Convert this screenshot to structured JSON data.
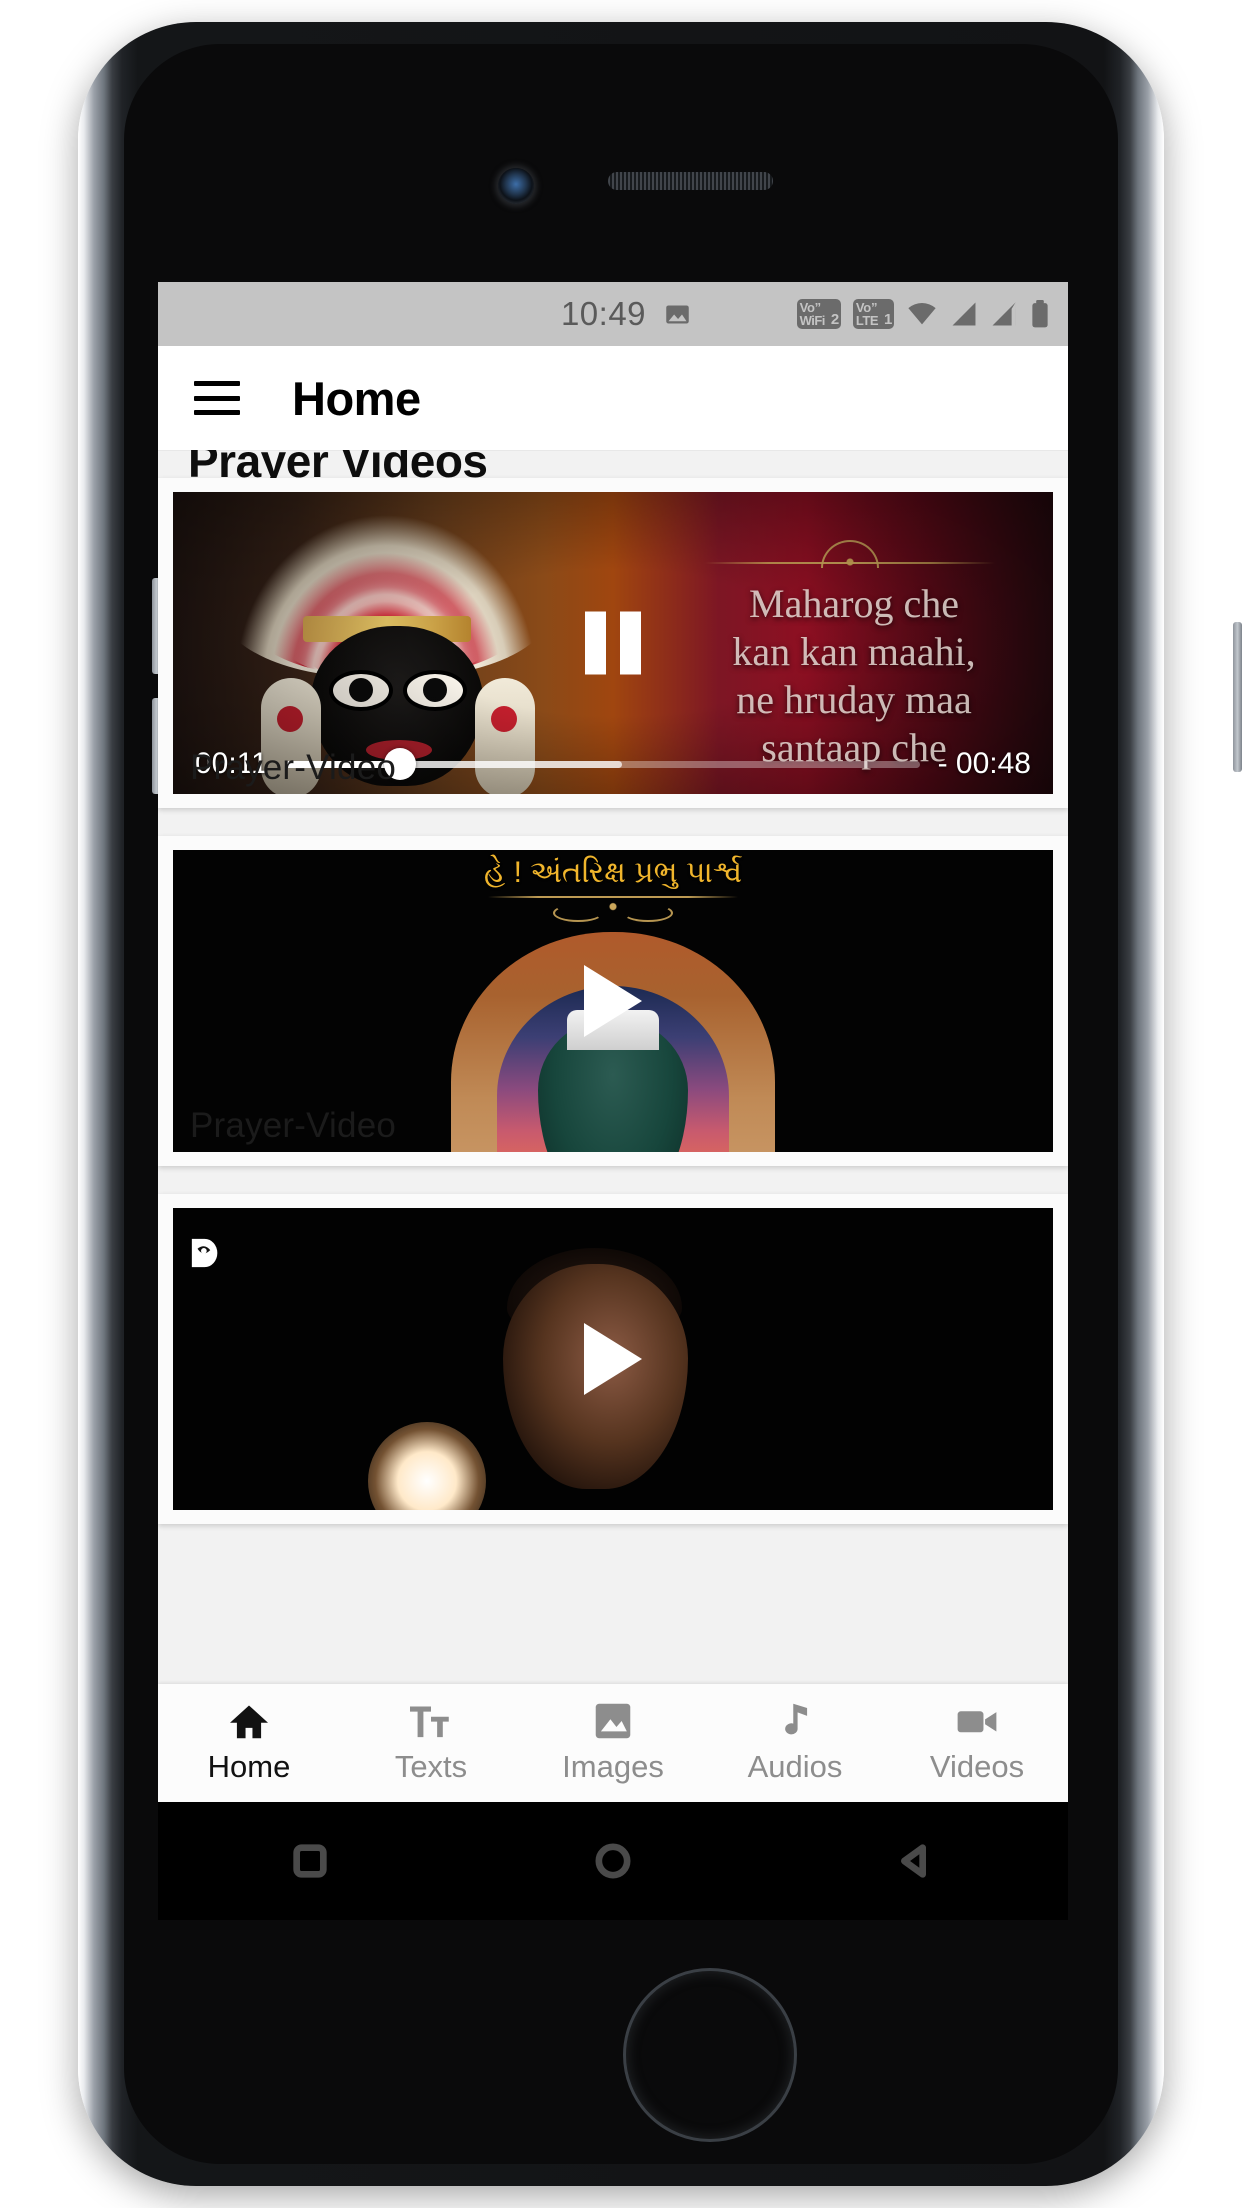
{
  "status_bar": {
    "clock": "10:49",
    "icons": [
      {
        "name": "photo-icon",
        "label": ""
      },
      {
        "name": "vowifi-icon",
        "line1": "Vo\"",
        "line2": "WiFi",
        "num": "2"
      },
      {
        "name": "volte-icon",
        "line1": "Vo\"",
        "line2": "LTE",
        "num": "1"
      },
      {
        "name": "wifi-icon",
        "label": ""
      },
      {
        "name": "signal-sim1-icon",
        "label": ""
      },
      {
        "name": "signal-sim2-icon",
        "label": ""
      },
      {
        "name": "battery-icon",
        "label": ""
      }
    ]
  },
  "app_bar": {
    "menu_icon": "hamburger-menu-icon",
    "title": "Home"
  },
  "content": {
    "section_title": "Prayer Videos",
    "cards": [
      {
        "label": "Prayer-Video",
        "state": "playing",
        "control_icon": "pause-icon",
        "elapsed": "00:11",
        "remaining": "- 00:48",
        "progress_percent": 18,
        "buffered_percent": 53,
        "overlay_lyrics": "Maharog che\nkan kan maahi,\nne hruday maa\nsantaap che"
      },
      {
        "label": "Prayer-Video",
        "state": "paused",
        "control_icon": "play-icon",
        "title_overlay": "હે ! અંતરિક્ષ પ્રભુ પાર્શ્વ"
      },
      {
        "label": "",
        "state": "paused",
        "control_icon": "play-icon",
        "placeholder_icon": "broken-image-icon"
      }
    ]
  },
  "bottom_nav": {
    "items": [
      {
        "label": "Home",
        "icon": "home-icon",
        "active": true
      },
      {
        "label": "Texts",
        "icon": "text-format-icon",
        "active": false
      },
      {
        "label": "Images",
        "icon": "image-icon",
        "active": false
      },
      {
        "label": "Audios",
        "icon": "music-note-icon",
        "active": false
      },
      {
        "label": "Videos",
        "icon": "video-camera-icon",
        "active": false
      }
    ]
  },
  "android_nav": {
    "keys": [
      {
        "name": "recents-key",
        "icon": "square-icon"
      },
      {
        "name": "home-key",
        "icon": "circle-icon"
      },
      {
        "name": "back-key",
        "icon": "triangle-left-icon"
      }
    ]
  },
  "colors": {
    "status_bar_bg": "#c4c4c4",
    "status_icon": "#6b6b6b",
    "app_bar_bg": "#ffffff",
    "nav_active": "#121212",
    "nav_inactive": "#8d8d8d",
    "accent_gold": "#f0b52c"
  }
}
